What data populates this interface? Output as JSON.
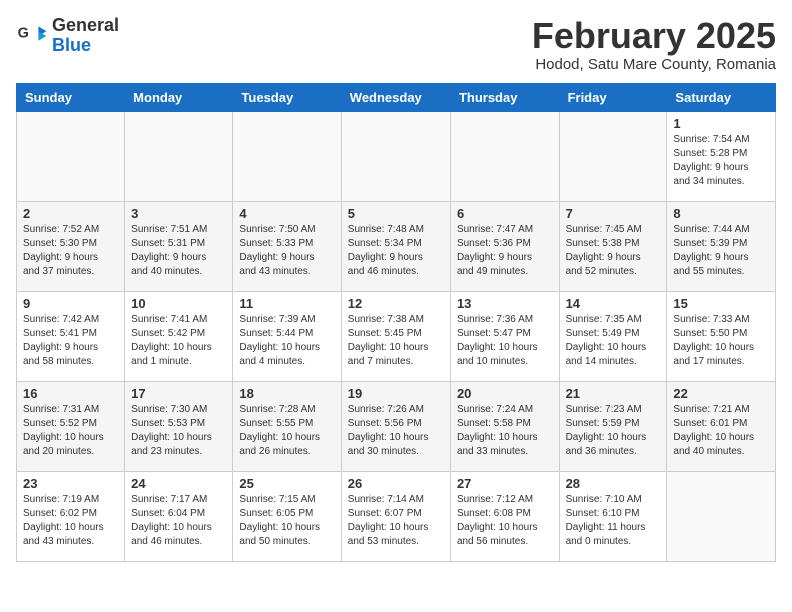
{
  "header": {
    "logo_general": "General",
    "logo_blue": "Blue",
    "month_title": "February 2025",
    "location": "Hodod, Satu Mare County, Romania"
  },
  "weekdays": [
    "Sunday",
    "Monday",
    "Tuesday",
    "Wednesday",
    "Thursday",
    "Friday",
    "Saturday"
  ],
  "weeks": [
    [
      {
        "day": "",
        "info": ""
      },
      {
        "day": "",
        "info": ""
      },
      {
        "day": "",
        "info": ""
      },
      {
        "day": "",
        "info": ""
      },
      {
        "day": "",
        "info": ""
      },
      {
        "day": "",
        "info": ""
      },
      {
        "day": "1",
        "info": "Sunrise: 7:54 AM\nSunset: 5:28 PM\nDaylight: 9 hours\nand 34 minutes."
      }
    ],
    [
      {
        "day": "2",
        "info": "Sunrise: 7:52 AM\nSunset: 5:30 PM\nDaylight: 9 hours\nand 37 minutes."
      },
      {
        "day": "3",
        "info": "Sunrise: 7:51 AM\nSunset: 5:31 PM\nDaylight: 9 hours\nand 40 minutes."
      },
      {
        "day": "4",
        "info": "Sunrise: 7:50 AM\nSunset: 5:33 PM\nDaylight: 9 hours\nand 43 minutes."
      },
      {
        "day": "5",
        "info": "Sunrise: 7:48 AM\nSunset: 5:34 PM\nDaylight: 9 hours\nand 46 minutes."
      },
      {
        "day": "6",
        "info": "Sunrise: 7:47 AM\nSunset: 5:36 PM\nDaylight: 9 hours\nand 49 minutes."
      },
      {
        "day": "7",
        "info": "Sunrise: 7:45 AM\nSunset: 5:38 PM\nDaylight: 9 hours\nand 52 minutes."
      },
      {
        "day": "8",
        "info": "Sunrise: 7:44 AM\nSunset: 5:39 PM\nDaylight: 9 hours\nand 55 minutes."
      }
    ],
    [
      {
        "day": "9",
        "info": "Sunrise: 7:42 AM\nSunset: 5:41 PM\nDaylight: 9 hours\nand 58 minutes."
      },
      {
        "day": "10",
        "info": "Sunrise: 7:41 AM\nSunset: 5:42 PM\nDaylight: 10 hours\nand 1 minute."
      },
      {
        "day": "11",
        "info": "Sunrise: 7:39 AM\nSunset: 5:44 PM\nDaylight: 10 hours\nand 4 minutes."
      },
      {
        "day": "12",
        "info": "Sunrise: 7:38 AM\nSunset: 5:45 PM\nDaylight: 10 hours\nand 7 minutes."
      },
      {
        "day": "13",
        "info": "Sunrise: 7:36 AM\nSunset: 5:47 PM\nDaylight: 10 hours\nand 10 minutes."
      },
      {
        "day": "14",
        "info": "Sunrise: 7:35 AM\nSunset: 5:49 PM\nDaylight: 10 hours\nand 14 minutes."
      },
      {
        "day": "15",
        "info": "Sunrise: 7:33 AM\nSunset: 5:50 PM\nDaylight: 10 hours\nand 17 minutes."
      }
    ],
    [
      {
        "day": "16",
        "info": "Sunrise: 7:31 AM\nSunset: 5:52 PM\nDaylight: 10 hours\nand 20 minutes."
      },
      {
        "day": "17",
        "info": "Sunrise: 7:30 AM\nSunset: 5:53 PM\nDaylight: 10 hours\nand 23 minutes."
      },
      {
        "day": "18",
        "info": "Sunrise: 7:28 AM\nSunset: 5:55 PM\nDaylight: 10 hours\nand 26 minutes."
      },
      {
        "day": "19",
        "info": "Sunrise: 7:26 AM\nSunset: 5:56 PM\nDaylight: 10 hours\nand 30 minutes."
      },
      {
        "day": "20",
        "info": "Sunrise: 7:24 AM\nSunset: 5:58 PM\nDaylight: 10 hours\nand 33 minutes."
      },
      {
        "day": "21",
        "info": "Sunrise: 7:23 AM\nSunset: 5:59 PM\nDaylight: 10 hours\nand 36 minutes."
      },
      {
        "day": "22",
        "info": "Sunrise: 7:21 AM\nSunset: 6:01 PM\nDaylight: 10 hours\nand 40 minutes."
      }
    ],
    [
      {
        "day": "23",
        "info": "Sunrise: 7:19 AM\nSunset: 6:02 PM\nDaylight: 10 hours\nand 43 minutes."
      },
      {
        "day": "24",
        "info": "Sunrise: 7:17 AM\nSunset: 6:04 PM\nDaylight: 10 hours\nand 46 minutes."
      },
      {
        "day": "25",
        "info": "Sunrise: 7:15 AM\nSunset: 6:05 PM\nDaylight: 10 hours\nand 50 minutes."
      },
      {
        "day": "26",
        "info": "Sunrise: 7:14 AM\nSunset: 6:07 PM\nDaylight: 10 hours\nand 53 minutes."
      },
      {
        "day": "27",
        "info": "Sunrise: 7:12 AM\nSunset: 6:08 PM\nDaylight: 10 hours\nand 56 minutes."
      },
      {
        "day": "28",
        "info": "Sunrise: 7:10 AM\nSunset: 6:10 PM\nDaylight: 11 hours\nand 0 minutes."
      },
      {
        "day": "",
        "info": ""
      }
    ]
  ]
}
